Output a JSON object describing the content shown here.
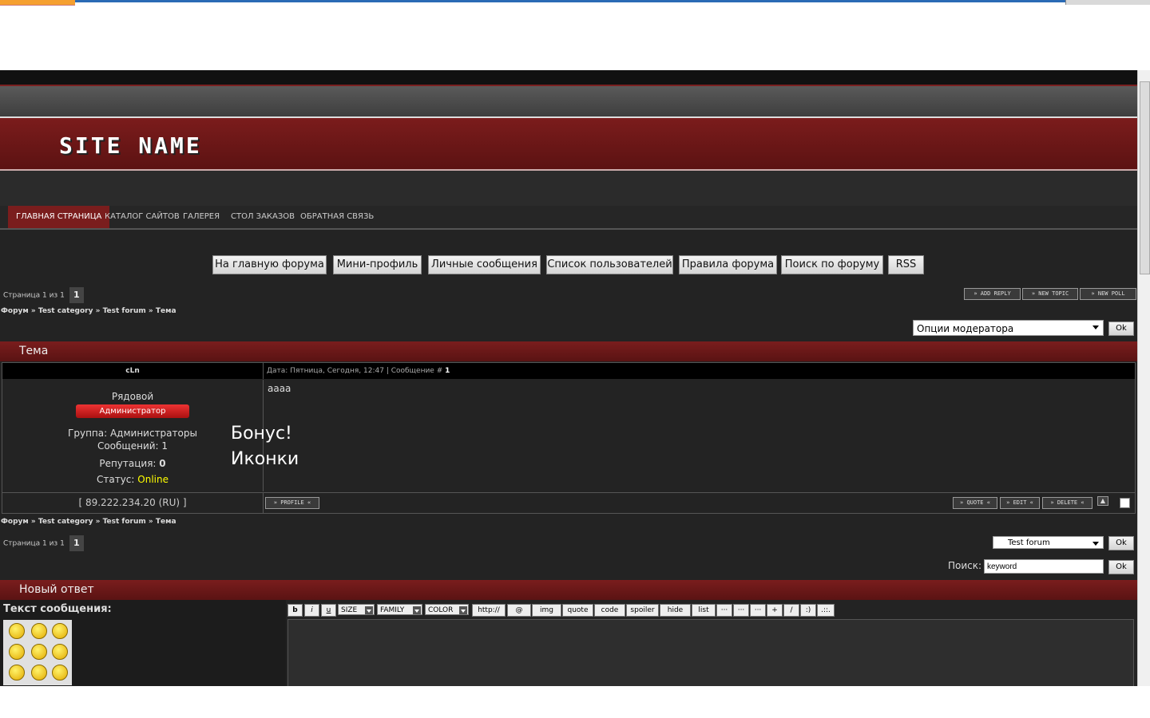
{
  "site": {
    "name": "SITE NAME",
    "nav": [
      "ГЛАВНАЯ СТРАНИЦА",
      "КАТАЛОГ САЙТОВ",
      "ГАЛЕРЕЯ",
      "СТОЛ ЗАКАЗОВ",
      "ОБРАТНАЯ СВЯЗЬ"
    ]
  },
  "forum_buttons": [
    "На главную форума",
    "Мини-профиль",
    "Личные сообщения",
    "Список пользователей",
    "Правила форума",
    "Поиск по форуму",
    "RSS"
  ],
  "pager": {
    "label": "Страница 1 из 1",
    "page": "1"
  },
  "breadcrumb": {
    "forum": "Форум",
    "sep": "»",
    "category": "Test category",
    "subforum": "Test forum",
    "topic": "Тема"
  },
  "topic_actions": {
    "add_reply": "ADD REPLY",
    "new_topic": "NEW TOPIC",
    "new_poll": "NEW POLL"
  },
  "moderator": {
    "select": "Опции модератора",
    "ok": "Ok"
  },
  "topic_header": "Тема",
  "post": {
    "author": "cLn",
    "meta_prefix": "Дата: Пятница, Сегодня, 12:47 | Сообщение #",
    "meta_num": "1",
    "rank": "Рядовой",
    "role_button": "Администратор",
    "group": "Группа: Администраторы",
    "messages": "Сообщений: 1",
    "reputation_label": "Репутация:",
    "reputation_value": "0",
    "status_label": "Статус:",
    "status_value": "Online",
    "ip": "89.222.234.20",
    "country": "(RU)",
    "text": "aaaa",
    "profile_btn": "PROFILE",
    "quote_btn": "QUOTE",
    "edit_btn": "EDIT",
    "delete_btn": "DELETE"
  },
  "annotation": {
    "line1": "Бонус!",
    "line2": "Иконки"
  },
  "jump": {
    "select": "Test forum",
    "ok": "Ok"
  },
  "search": {
    "label": "Поиск:",
    "value": "keyword",
    "ok": "Ok"
  },
  "reply_header": "Новый ответ",
  "message_label": "Текст сообщения:",
  "toolbar": [
    "b",
    "i",
    "u",
    "SIZE",
    "FAMILY",
    "COLOR",
    "http://",
    "@",
    "img",
    "quote",
    "code",
    "spoiler",
    "hide",
    "list",
    "···",
    "···",
    "···",
    "+",
    "/",
    ":)",
    ".::."
  ],
  "colors": {
    "accent": "#7a1d1d",
    "background": "#232323",
    "online": "#ffff00"
  }
}
